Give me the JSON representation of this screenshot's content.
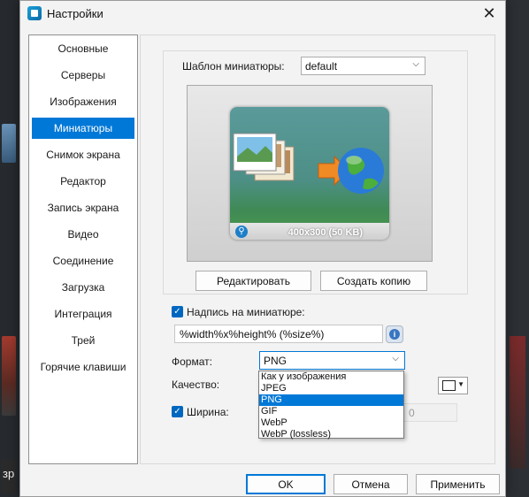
{
  "window": {
    "title": "Настройки"
  },
  "sidebar": {
    "items": [
      {
        "label": "Основные"
      },
      {
        "label": "Серверы"
      },
      {
        "label": "Изображения"
      },
      {
        "label": "Миниатюры",
        "active": true
      },
      {
        "label": "Снимок экрана"
      },
      {
        "label": "Редактор"
      },
      {
        "label": "Запись экрана"
      },
      {
        "label": "Видео"
      },
      {
        "label": "Соединение"
      },
      {
        "label": "Загрузка"
      },
      {
        "label": "Интеграция"
      },
      {
        "label": "Трей"
      },
      {
        "label": "Горячие клавиши"
      }
    ]
  },
  "template": {
    "label": "Шаблон миниатюры:",
    "value": "default"
  },
  "preview": {
    "caption": "400x300 (50 KB)"
  },
  "buttons": {
    "edit": "Редактировать",
    "copy": "Создать копию",
    "ok": "OK",
    "cancel": "Отмена",
    "apply": "Применить"
  },
  "caption_option": {
    "label": "Надпись на миниатюре:",
    "checked": true,
    "value": "%width%x%height% (%size%)"
  },
  "format": {
    "label": "Формат:",
    "value": "PNG",
    "options": [
      "Как у изображения",
      "JPEG",
      "PNG",
      "GIF",
      "WebP",
      "WebP (lossless)"
    ],
    "selected_index": 2
  },
  "quality": {
    "label": "Качество:"
  },
  "width": {
    "label": "Ширина:",
    "checked": true,
    "height_value": "0"
  },
  "background": {
    "text": "зр"
  },
  "colors": {
    "accent": "#0078d7"
  }
}
